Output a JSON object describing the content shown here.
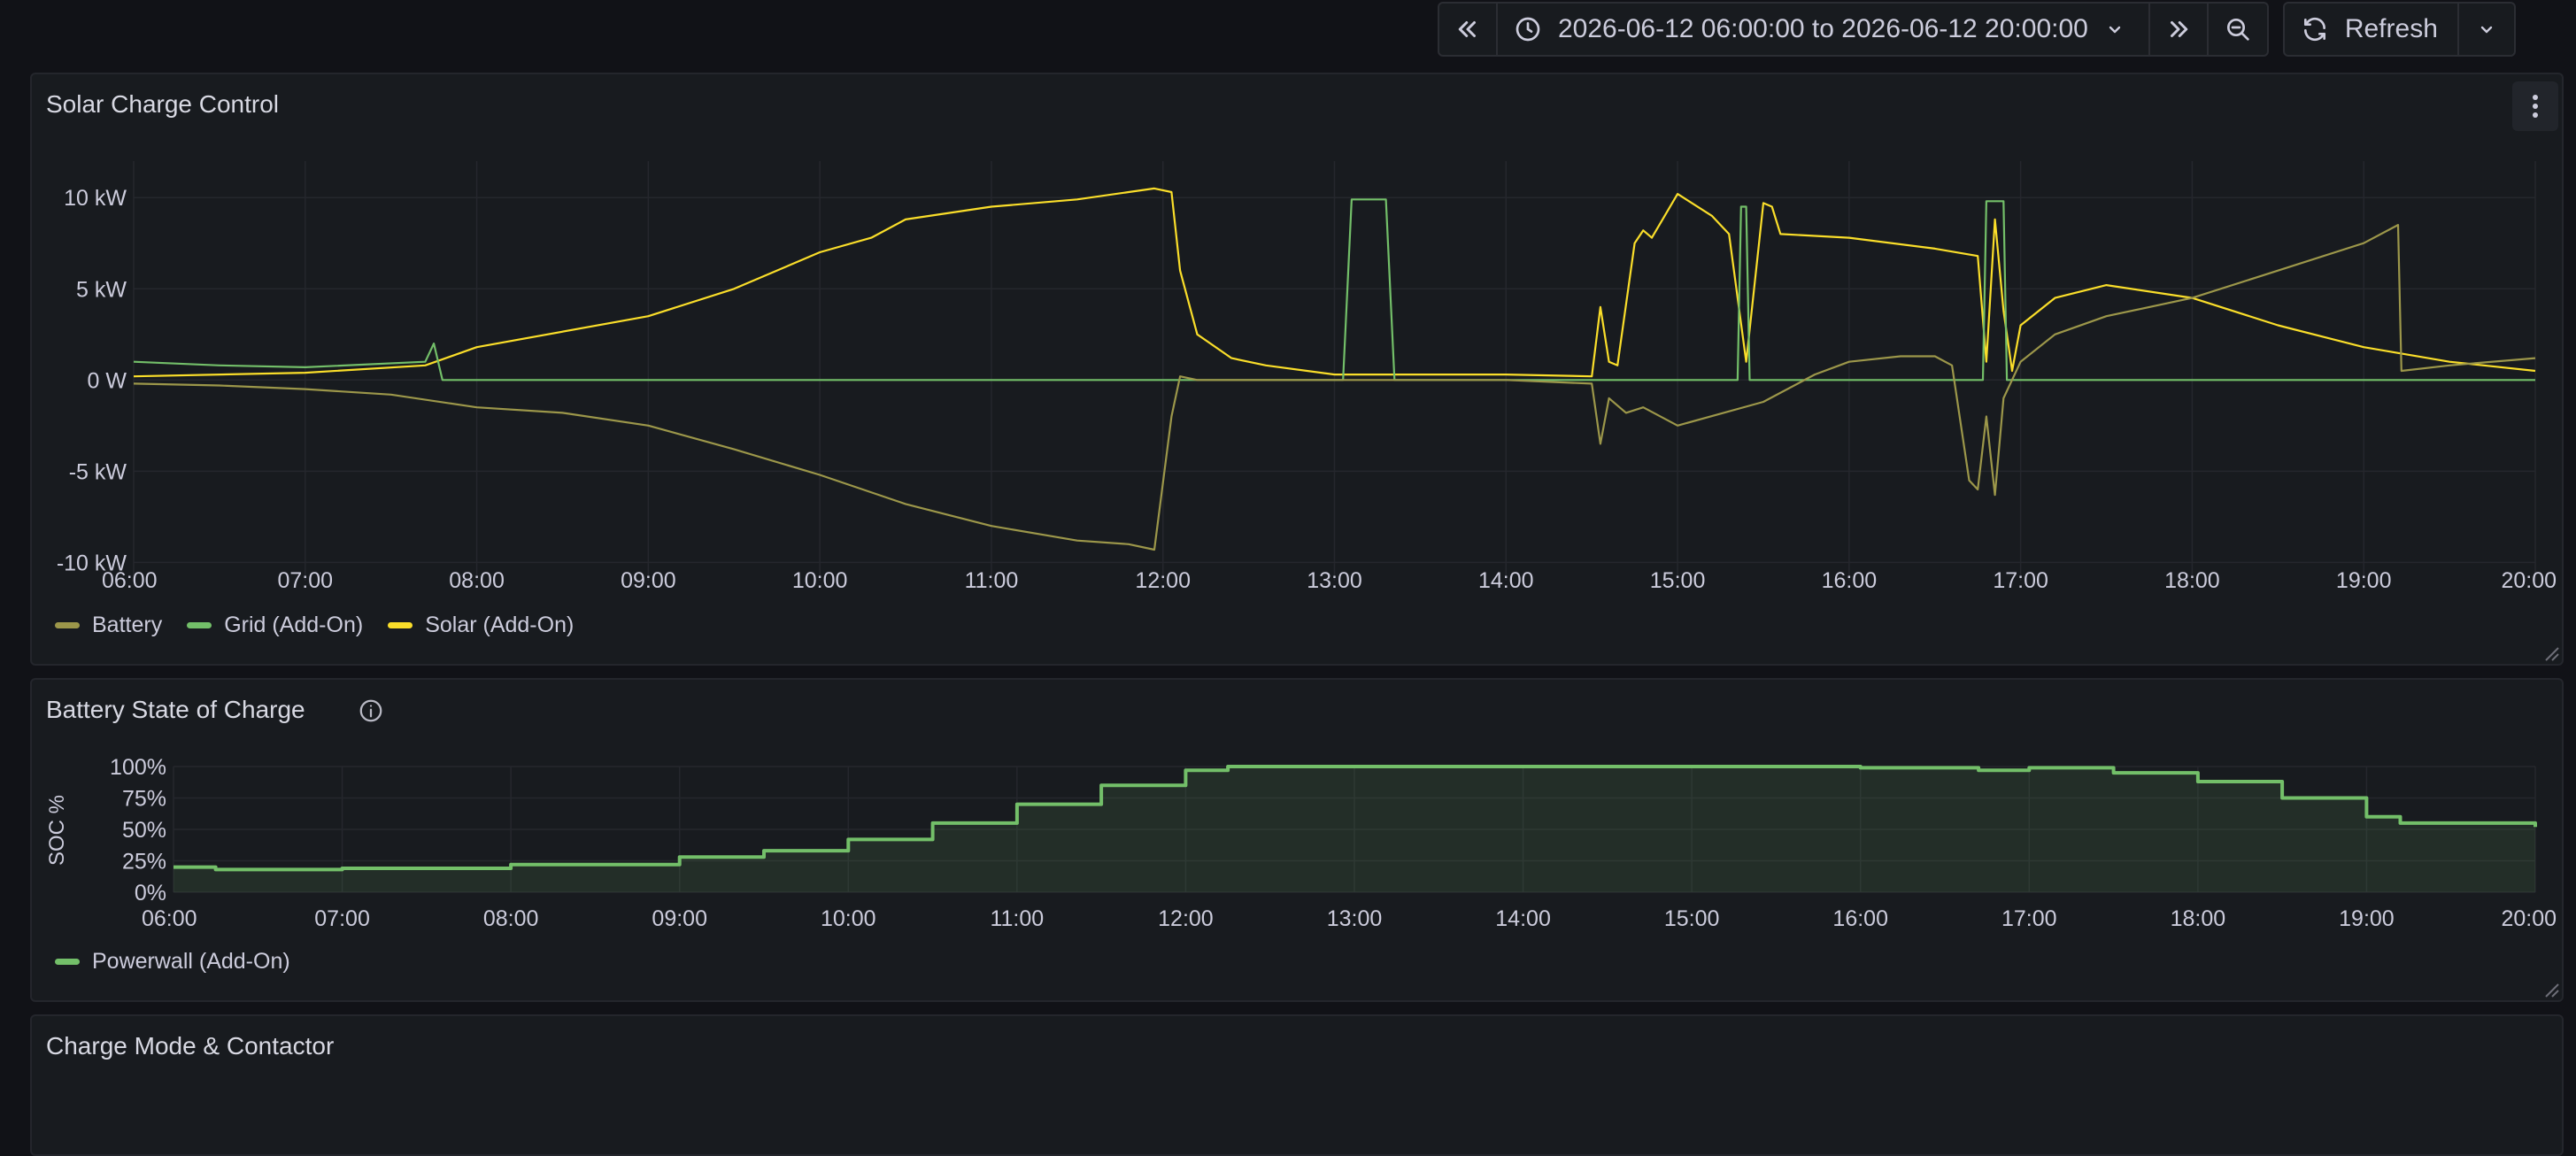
{
  "toolbar": {
    "time_range": "2026-06-12 06:00:00 to 2026-06-12 20:00:00",
    "refresh_label": "Refresh"
  },
  "colors": {
    "battery": "#9c974a",
    "grid": "#73bf69",
    "solar": "#fade2a",
    "panel_bg": "#181b1f",
    "grid_lines": "#25272d"
  },
  "panels": {
    "solar": {
      "title": "Solar Charge Control"
    },
    "soc": {
      "title": "Battery State of Charge",
      "y_label": "SOC %"
    },
    "charge": {
      "title": "Charge Mode & Contactor"
    }
  },
  "chart_data": [
    {
      "type": "line",
      "title": "Solar Charge Control",
      "x_ticks": [
        "06:00",
        "07:00",
        "08:00",
        "09:00",
        "10:00",
        "11:00",
        "12:00",
        "13:00",
        "14:00",
        "15:00",
        "16:00",
        "17:00",
        "18:00",
        "19:00",
        "20:00"
      ],
      "y_ticks": [
        "10 kW",
        "5 kW",
        "0 W",
        "-5 kW",
        "-10 kW"
      ],
      "ylim": [
        -11,
        12
      ],
      "units": "kW",
      "legend_placement": "bottom-left",
      "series": [
        {
          "name": "Solar (Add-On)",
          "color": "#fade2a",
          "x": [
            6.0,
            7.0,
            7.7,
            8.0,
            9.0,
            9.5,
            10.0,
            10.3,
            10.5,
            11.0,
            11.5,
            11.8,
            11.95,
            12.05,
            12.1,
            12.2,
            12.4,
            12.6,
            13.0,
            13.5,
            14.0,
            14.5,
            14.55,
            14.6,
            14.65,
            14.75,
            14.8,
            14.85,
            15.0,
            15.2,
            15.3,
            15.4,
            15.5,
            15.55,
            15.6,
            16.0,
            16.5,
            16.75,
            16.8,
            16.85,
            16.9,
            16.95,
            17.0,
            17.2,
            17.5,
            18.0,
            18.5,
            19.0,
            19.5,
            20.0
          ],
          "y": [
            0.2,
            0.4,
            0.8,
            1.8,
            3.5,
            5.0,
            7.0,
            7.8,
            8.8,
            9.5,
            9.9,
            10.3,
            10.5,
            10.3,
            6.0,
            2.5,
            1.2,
            0.8,
            0.3,
            0.3,
            0.3,
            0.2,
            4.0,
            1.0,
            0.8,
            7.5,
            8.2,
            7.8,
            10.2,
            9.0,
            8.0,
            1.0,
            9.7,
            9.5,
            8.0,
            7.8,
            7.2,
            6.8,
            1.0,
            8.8,
            3.8,
            0.5,
            3.0,
            4.5,
            5.2,
            4.5,
            3.0,
            1.8,
            1.0,
            0.5
          ]
        },
        {
          "name": "Grid (Add-On)",
          "color": "#73bf69",
          "x": [
            6.0,
            6.5,
            7.0,
            7.7,
            7.75,
            7.8,
            7.85,
            13.05,
            13.1,
            13.3,
            13.35,
            15.35,
            15.37,
            15.4,
            15.42,
            16.78,
            16.8,
            16.9,
            16.92,
            20.0
          ],
          "y": [
            1.0,
            0.8,
            0.7,
            1.0,
            2.0,
            0.0,
            0.0,
            0.0,
            9.9,
            9.9,
            0.0,
            0.0,
            9.5,
            9.5,
            0.0,
            0.0,
            9.8,
            9.8,
            0.0,
            0.0
          ]
        },
        {
          "name": "Battery",
          "color": "#9c974a",
          "x": [
            6.0,
            6.5,
            7.0,
            7.5,
            8.0,
            8.5,
            9.0,
            9.5,
            10.0,
            10.5,
            11.0,
            11.5,
            11.8,
            11.95,
            12.05,
            12.1,
            12.2,
            13.0,
            13.5,
            14.0,
            14.5,
            14.55,
            14.6,
            14.7,
            14.8,
            15.0,
            15.5,
            15.8,
            16.0,
            16.3,
            16.5,
            16.6,
            16.7,
            16.75,
            16.8,
            16.85,
            16.9,
            17.0,
            17.2,
            17.5,
            18.0,
            18.5,
            19.0,
            19.2,
            19.22,
            19.5,
            20.0
          ],
          "y": [
            -0.2,
            -0.3,
            -0.5,
            -0.8,
            -1.5,
            -1.8,
            -2.5,
            -3.8,
            -5.2,
            -6.8,
            -8.0,
            -8.8,
            -9.0,
            -9.3,
            -2.0,
            0.2,
            0.0,
            0.0,
            0.0,
            0.0,
            -0.2,
            -3.5,
            -1.0,
            -1.8,
            -1.5,
            -2.5,
            -1.2,
            0.3,
            1.0,
            1.3,
            1.3,
            0.8,
            -5.5,
            -6.0,
            -2.0,
            -6.3,
            -1.0,
            1.0,
            2.5,
            3.5,
            4.5,
            6.0,
            7.5,
            8.5,
            0.5,
            0.8,
            1.2
          ]
        }
      ]
    },
    {
      "type": "area",
      "title": "Battery State of Charge",
      "ylabel": "SOC %",
      "x_ticks": [
        "06:00",
        "07:00",
        "08:00",
        "09:00",
        "10:00",
        "11:00",
        "12:00",
        "13:00",
        "14:00",
        "15:00",
        "16:00",
        "17:00",
        "18:00",
        "19:00",
        "20:00"
      ],
      "y_ticks": [
        "100%",
        "75%",
        "50%",
        "25%",
        "0%"
      ],
      "ylim": [
        0,
        100
      ],
      "legend_placement": "bottom-left",
      "series": [
        {
          "name": "Powerwall (Add-On)",
          "color": "#73bf69",
          "x": [
            6.0,
            6.25,
            7.0,
            8.0,
            9.0,
            9.5,
            10.0,
            10.5,
            11.0,
            11.5,
            12.0,
            12.25,
            13.0,
            14.0,
            15.0,
            16.0,
            16.7,
            17.0,
            17.5,
            18.0,
            18.5,
            19.0,
            19.2,
            20.0
          ],
          "y": [
            20,
            18,
            19,
            22,
            28,
            33,
            42,
            55,
            70,
            85,
            97,
            100,
            100,
            100,
            100,
            99,
            97,
            99,
            95,
            88,
            75,
            60,
            55,
            52
          ]
        }
      ]
    }
  ]
}
